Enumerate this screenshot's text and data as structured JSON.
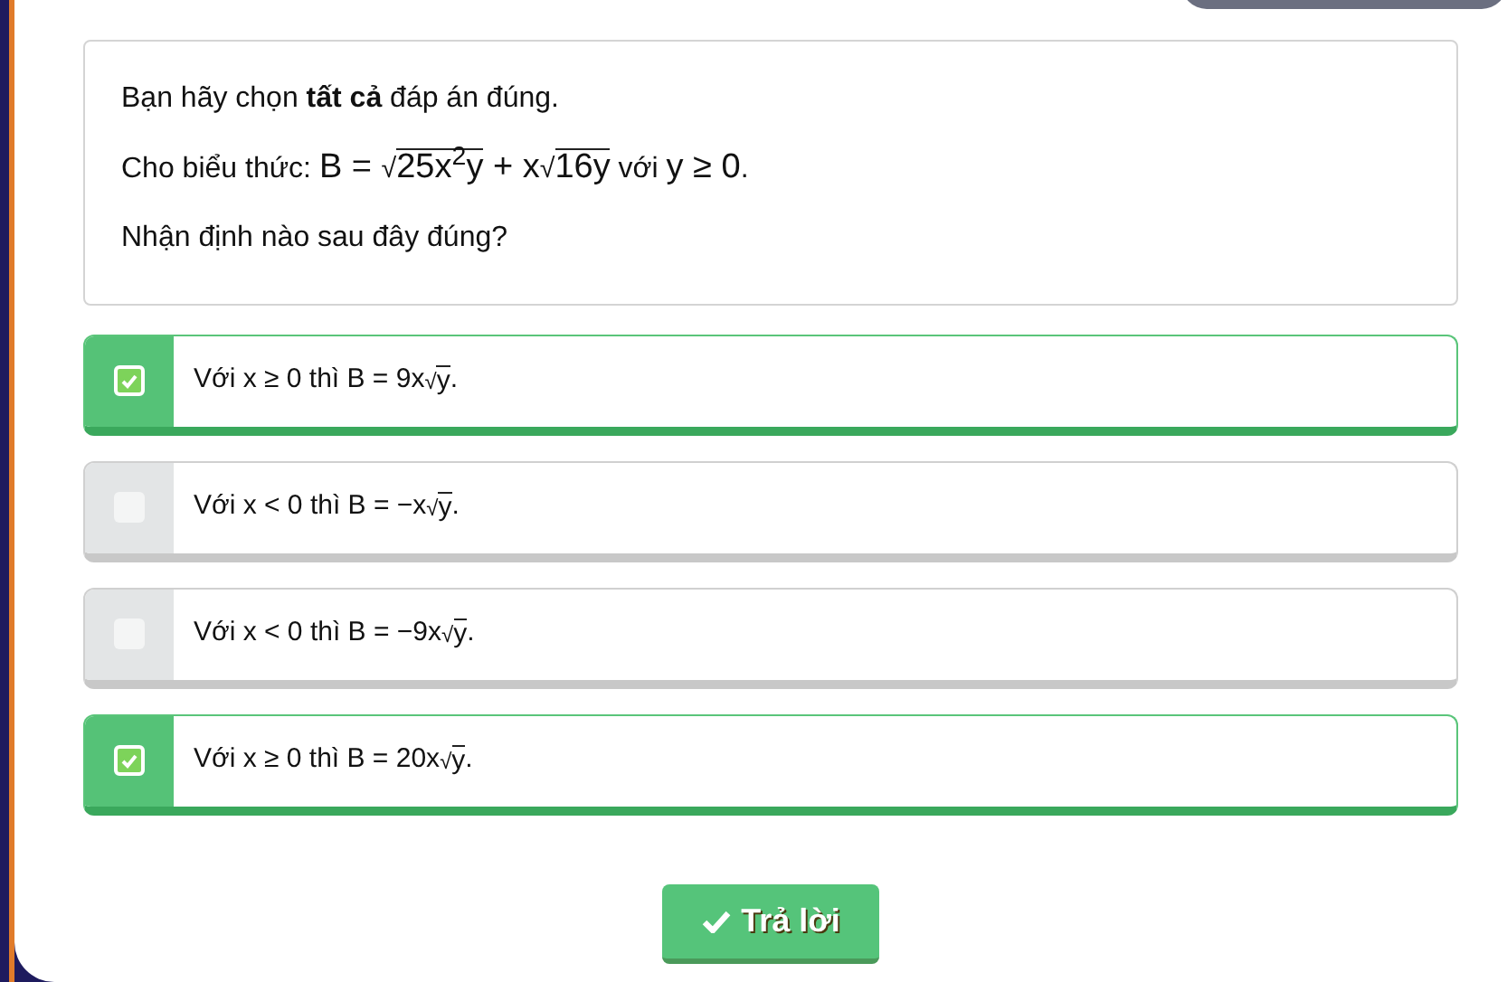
{
  "question": {
    "lines": [
      [
        {
          "kind": "text",
          "text": "Bạn hãy chọn **tất cả** đáp án đúng."
        }
      ],
      [
        {
          "kind": "text",
          "text": "Cho biểu thức: "
        },
        {
          "kind": "math",
          "text": "B = "
        },
        {
          "kind": "sqrt",
          "sign": "√",
          "radicand": "25x$^{2}$y"
        },
        {
          "kind": "math",
          "text": " + x"
        },
        {
          "kind": "sqrt",
          "sign": "√",
          "radicand": "16y"
        },
        {
          "kind": "text",
          "text": " với "
        },
        {
          "kind": "math",
          "text": "y ≥ 0"
        },
        {
          "kind": "text",
          "text": "."
        }
      ],
      [
        {
          "kind": "text",
          "text": "Nhận định nào sau đây đúng?"
        }
      ]
    ]
  },
  "options": [
    {
      "checked": true,
      "parts": [
        {
          "kind": "text",
          "text": "Với x ≥ 0 thì B = 9x"
        },
        {
          "kind": "sqrt",
          "sign": "√",
          "radicand": "y"
        },
        {
          "kind": "text",
          "text": "."
        }
      ]
    },
    {
      "checked": false,
      "parts": [
        {
          "kind": "text",
          "text": "Với x < 0 thì B = −x"
        },
        {
          "kind": "sqrt",
          "sign": "√",
          "radicand": "y"
        },
        {
          "kind": "text",
          "text": "."
        }
      ]
    },
    {
      "checked": false,
      "parts": [
        {
          "kind": "text",
          "text": "Với x < 0 thì B = −9x"
        },
        {
          "kind": "sqrt",
          "sign": "√",
          "radicand": "y"
        },
        {
          "kind": "text",
          "text": "."
        }
      ]
    },
    {
      "checked": true,
      "parts": [
        {
          "kind": "text",
          "text": "Với x ≥ 0 thì B = 20x"
        },
        {
          "kind": "sqrt",
          "sign": "√",
          "radicand": "y"
        },
        {
          "kind": "text",
          "text": "."
        }
      ]
    }
  ],
  "submit": {
    "label": "Trả lời"
  }
}
